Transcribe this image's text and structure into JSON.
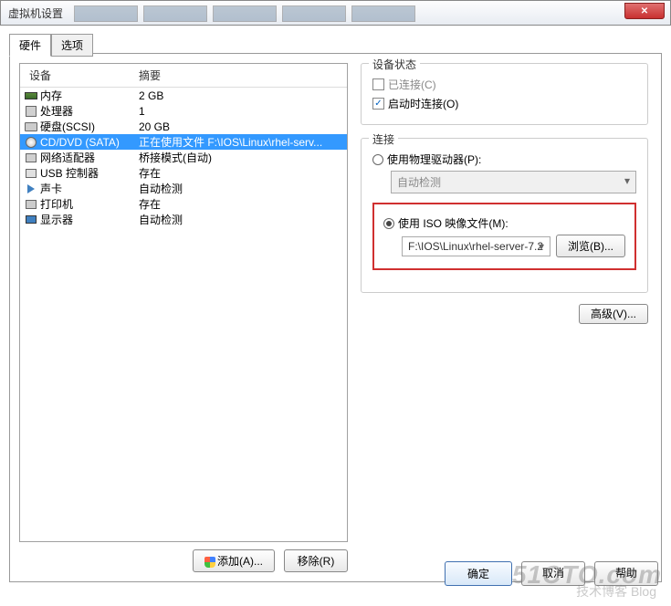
{
  "window": {
    "title": "虚拟机设置"
  },
  "tabs": {
    "hardware": "硬件",
    "options": "选项"
  },
  "list": {
    "header_device": "设备",
    "header_summary": "摘要",
    "rows": [
      {
        "device": "内存",
        "summary": "2 GB"
      },
      {
        "device": "处理器",
        "summary": "1"
      },
      {
        "device": "硬盘(SCSI)",
        "summary": "20 GB"
      },
      {
        "device": "CD/DVD (SATA)",
        "summary": "正在使用文件 F:\\IOS\\Linux\\rhel-serv..."
      },
      {
        "device": "网络适配器",
        "summary": "桥接模式(自动)"
      },
      {
        "device": "USB 控制器",
        "summary": "存在"
      },
      {
        "device": "声卡",
        "summary": "自动检测"
      },
      {
        "device": "打印机",
        "summary": "存在"
      },
      {
        "device": "显示器",
        "summary": "自动检测"
      }
    ]
  },
  "left_buttons": {
    "add": "添加(A)...",
    "remove": "移除(R)"
  },
  "status": {
    "legend": "设备状态",
    "connected": "已连接(C)",
    "connect_on_start": "启动时连接(O)"
  },
  "connection": {
    "legend": "连接",
    "physical": "使用物理驱动器(P):",
    "physical_value": "自动检测",
    "iso": "使用 ISO 映像文件(M):",
    "iso_value": "F:\\IOS\\Linux\\rhel-server-7.2",
    "browse": "浏览(B)..."
  },
  "advanced": "高级(V)...",
  "footer": {
    "ok": "确定",
    "cancel": "取消",
    "help": "帮助"
  },
  "watermark": {
    "main": "51CTO.com",
    "sub": "技术博客 Blog"
  }
}
